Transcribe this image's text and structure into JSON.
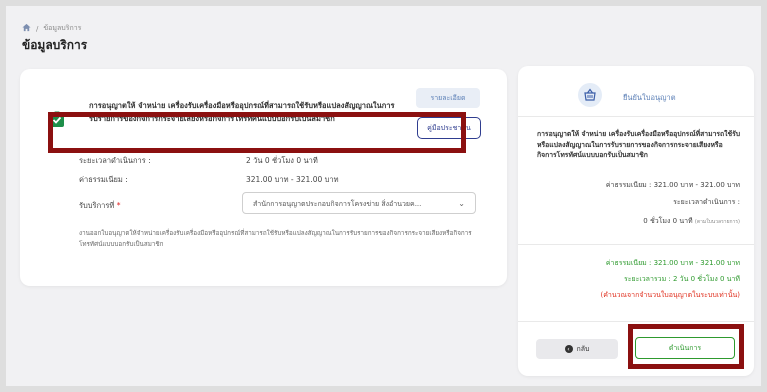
{
  "breadcrumb": {
    "current": "ข้อมูลบริการ"
  },
  "page": {
    "title": "ข้อมูลบริการ"
  },
  "license": {
    "title": "การอนุญาตให้ จำหน่าย เครื่องรับเครื่องมือหรืออุปกรณ์ที่สามารถใช้รับหรือแปลงสัญญาณในการรับรายการของกิจการกระจายเสียงหรือกิจการโทรทัศน์แบบบอกรับเป็นสมาชิก",
    "detail_button": "รายละเอียด",
    "manual_button": "คู่มือประชาชน"
  },
  "info": {
    "duration_label": "ระยะเวลาดำเนินการ :",
    "duration_value": "2 วัน 0 ชั่วโมง 0 นาที",
    "fee_label": "ค่าธรรมเนียม :",
    "fee_value": "321.00 บาท - 321.00 บาท"
  },
  "service_select": {
    "label": "รับบริการที่",
    "required_mark": "*",
    "value": "สำนักการอนุญาตประกอบกิจการโครงข่าย สิ่งอำนวยค..."
  },
  "note": "งานออกใบอนุญาตให้จำหน่ายเครื่องรับเครื่องมือหรืออุปกรณ์ที่สามารถใช้รับหรือแปลงสัญญาณในการรับรายการของกิจการกระจายเสียงหรือกิจการโทรทัศน์แบบบอกรับเป็นสมาชิก",
  "side": {
    "header": "ยืนยันใบอนุญาต",
    "title": "การอนุญาตให้ จำหน่าย เครื่องรับเครื่องมือหรืออุปกรณ์ที่สามารถใช้รับหรือแปลงสัญญาณในการรับรายการของกิจการกระจายเสียงหรือกิจการโทรทัศน์แบบบอกรับเป็นสมาชิก",
    "fee_line": "ค่าธรรมเนียม  :   321.00 บาท - 321.00 บาท",
    "duration_label": "ระยะเวลาดำเนินการ  :",
    "duration_value": "0 ชั่วโมง 0 นาที",
    "duration_note": "(ตามใบนวลรายการ)",
    "total_fee": "ค่าธรรมเนียม  :   321.00 บาท - 321.00 บาท",
    "total_time": "ระยะเวลารวม :   2 วัน 0 ชั่วโมง 0 นาที",
    "calc_note": "(คำนวณจากจำนวนใบอนุญาตในระบบเท่านั้น)",
    "back_button": "กลับ",
    "proceed_button": "ดำเนินการ"
  },
  "colors": {
    "accent_blue": "#2f3d8f",
    "green": "#2e9a2e",
    "red": "#e0301f",
    "highlight": "#8b1010"
  }
}
